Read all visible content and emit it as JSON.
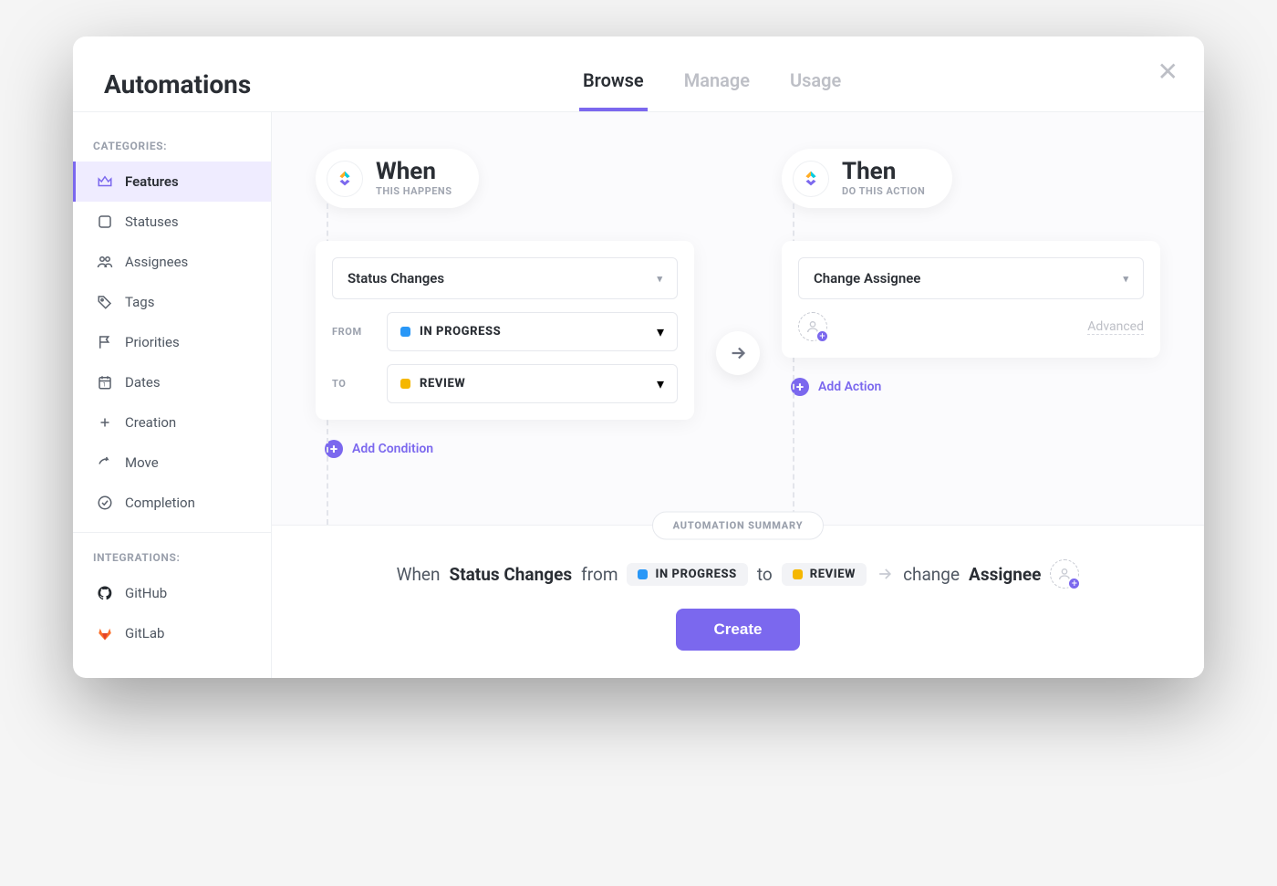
{
  "header": {
    "title": "Automations",
    "tabs": [
      {
        "label": "Browse",
        "active": true
      },
      {
        "label": "Manage",
        "active": false
      },
      {
        "label": "Usage",
        "active": false
      }
    ]
  },
  "sidebar": {
    "categories_heading": "CATEGORIES:",
    "integrations_heading": "INTEGRATIONS:",
    "categories": [
      {
        "label": "Features",
        "icon": "crown-icon",
        "active": true
      },
      {
        "label": "Statuses",
        "icon": "square-icon",
        "active": false
      },
      {
        "label": "Assignees",
        "icon": "people-icon",
        "active": false
      },
      {
        "label": "Tags",
        "icon": "tag-icon",
        "active": false
      },
      {
        "label": "Priorities",
        "icon": "flag-icon",
        "active": false
      },
      {
        "label": "Dates",
        "icon": "calendar-icon",
        "active": false
      },
      {
        "label": "Creation",
        "icon": "plus-square-icon",
        "active": false
      },
      {
        "label": "Move",
        "icon": "share-icon",
        "active": false
      },
      {
        "label": "Completion",
        "icon": "check-circle-icon",
        "active": false
      }
    ],
    "integrations": [
      {
        "label": "GitHub",
        "icon": "github-icon"
      },
      {
        "label": "GitLab",
        "icon": "gitlab-icon"
      }
    ]
  },
  "when": {
    "title": "When",
    "subtitle": "THIS HAPPENS",
    "trigger": "Status Changes",
    "from_label": "FROM",
    "from_status": "IN PROGRESS",
    "from_color": "#2997f7",
    "to_label": "TO",
    "to_status": "REVIEW",
    "to_color": "#f5b700",
    "add_condition": "Add Condition"
  },
  "then": {
    "title": "Then",
    "subtitle": "DO THIS ACTION",
    "action": "Change Assignee",
    "advanced": "Advanced",
    "add_action": "Add Action"
  },
  "summary": {
    "heading": "AUTOMATION SUMMARY",
    "when_word": "When",
    "trigger_bold": "Status Changes",
    "from_word": "from",
    "from_status": "IN PROGRESS",
    "from_color": "#2997f7",
    "to_word": "to",
    "to_status": "REVIEW",
    "to_color": "#f5b700",
    "change_word": "change",
    "action_bold": "Assignee",
    "create_label": "Create"
  }
}
